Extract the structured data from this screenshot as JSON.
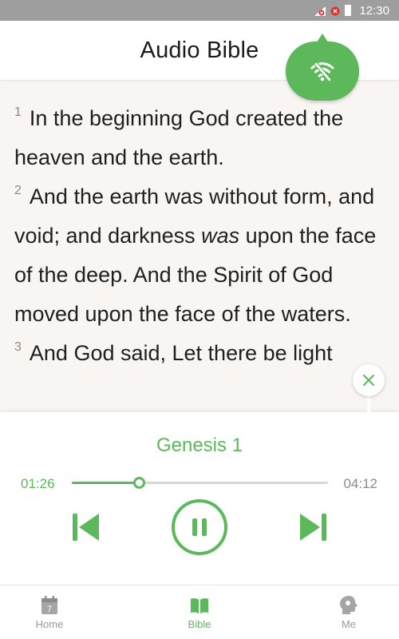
{
  "status_bar": {
    "time": "12:30"
  },
  "header": {
    "title": "Audio Bible"
  },
  "reader": {
    "verses": [
      {
        "num": "1",
        "text": "In the beginning God created the heaven and the earth."
      },
      {
        "num": "2",
        "pre": "And the earth was without form, and void; and darkness ",
        "italic": "was",
        "post": " upon the face of the deep. And the Spirit of God moved upon the face of the waters."
      },
      {
        "num": "3",
        "text": "And God said, Let there be light"
      }
    ]
  },
  "player": {
    "chapter_title": "Genesis 1",
    "time_elapsed": "01:26",
    "time_total": "04:12",
    "progress_fraction": 0.262
  },
  "bottom_nav": {
    "items": [
      {
        "label": "Home",
        "icon": "calendar-icon",
        "badge": "7"
      },
      {
        "label": "Bible",
        "icon": "book-icon"
      },
      {
        "label": "Me",
        "icon": "profile-head-icon"
      }
    ]
  },
  "colors": {
    "accent": "#5db85c",
    "status_bar": "#9e9e9e",
    "reader_bg": "#f8f5f2"
  }
}
